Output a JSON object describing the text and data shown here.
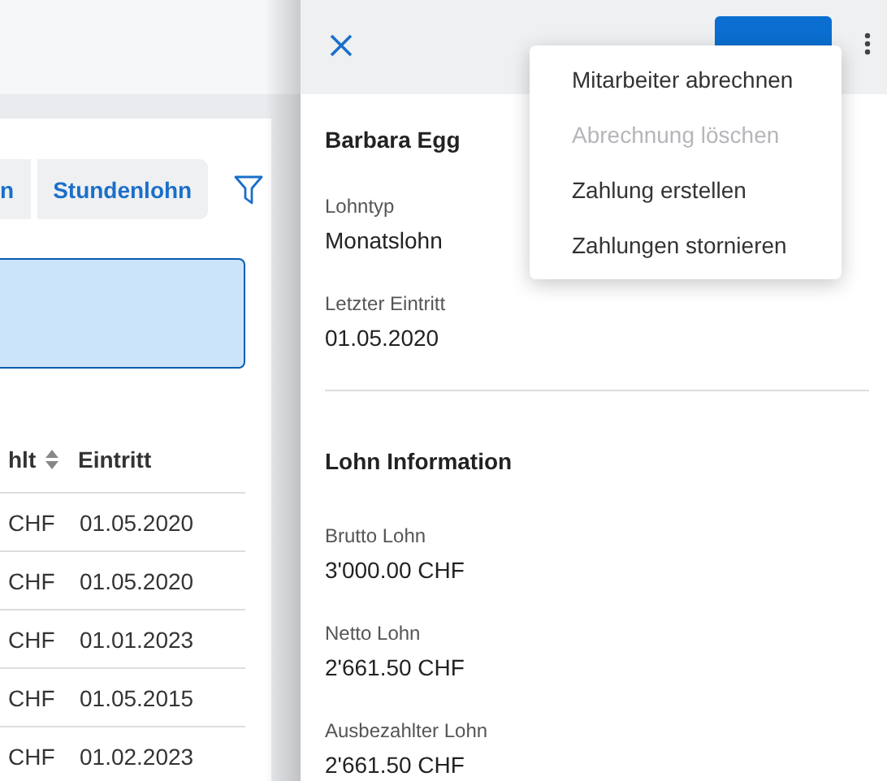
{
  "background_page": {
    "tabs": [
      {
        "label": "n",
        "selected": false
      },
      {
        "label": "Stundenlohn",
        "selected": false
      }
    ],
    "table": {
      "columns": [
        "hlt",
        "Eintritt"
      ],
      "rows": [
        [
          "CHF",
          "01.05.2020"
        ],
        [
          "CHF",
          "01.05.2020"
        ],
        [
          "CHF",
          "01.01.2023"
        ],
        [
          "CHF",
          "01.05.2015"
        ],
        [
          "CHF",
          "01.02.2023"
        ]
      ]
    }
  },
  "panel": {
    "name": "Barbara Egg",
    "sections": [
      {
        "fields": [
          {
            "label": "Lohntyp",
            "value": "Monatslohn"
          },
          {
            "label": "Letzter Eintritt",
            "value": "01.05.2020"
          }
        ]
      },
      {
        "title": "Lohn Information",
        "fields": [
          {
            "label": "Brutto Lohn",
            "value": "3'000.00 CHF"
          },
          {
            "label": "Netto Lohn",
            "value": "2'661.50 CHF"
          },
          {
            "label": "Ausbezahlter Lohn",
            "value": "2'661.50 CHF"
          }
        ]
      }
    ]
  },
  "menu": {
    "items": [
      {
        "label": "Mitarbeiter abrechnen",
        "disabled": false
      },
      {
        "label": "Abrechnung löschen",
        "disabled": true
      },
      {
        "label": "Zahlung erstellen",
        "disabled": false
      },
      {
        "label": "Zahlungen stornieren",
        "disabled": false
      }
    ]
  }
}
